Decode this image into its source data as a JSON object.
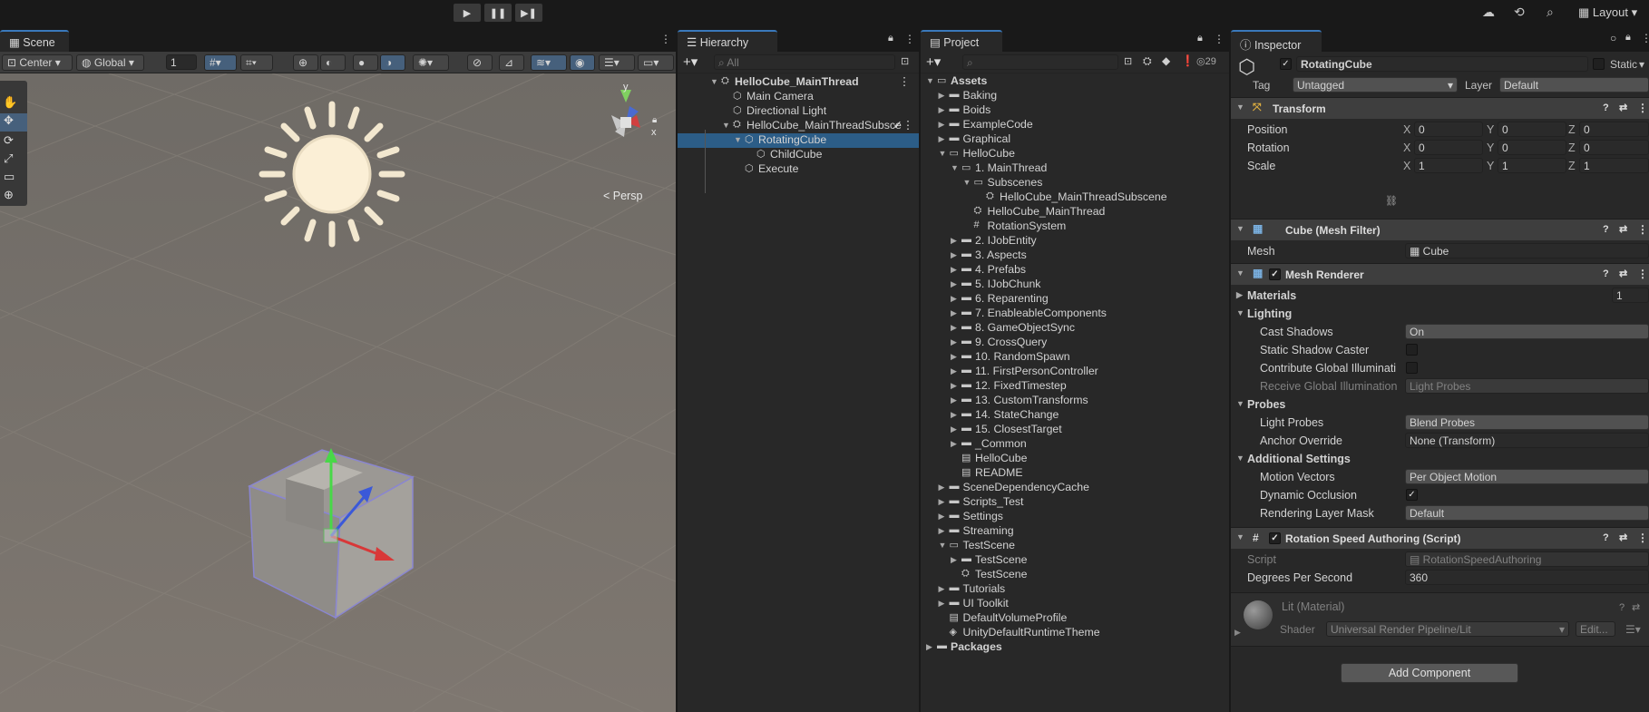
{
  "toolbar": {
    "play_icon": "play-icon",
    "pause_icon": "pause-icon",
    "step_icon": "step-icon",
    "layout_label": "Layout"
  },
  "scene": {
    "tab_label": "Scene",
    "pivot": "Center",
    "space": "Global",
    "snap_value": "1",
    "persp_label": "< Persp",
    "axes": {
      "y": "y",
      "x": "x"
    }
  },
  "hierarchy": {
    "tab_label": "Hierarchy",
    "search_placeholder": "All",
    "items": [
      {
        "label": "HelloCube_MainThread",
        "indent": 0,
        "arrow": "▼",
        "icon": "unity-scene-icon",
        "bold": true,
        "selected": false
      },
      {
        "label": "Main Camera",
        "indent": 1,
        "arrow": "",
        "icon": "gameobject-icon",
        "bold": false,
        "selected": false
      },
      {
        "label": "Directional Light",
        "indent": 1,
        "arrow": "",
        "icon": "gameobject-icon",
        "bold": false,
        "selected": false
      },
      {
        "label": "HelloCube_MainThreadSubsce",
        "indent": 1,
        "arrow": "▼",
        "icon": "subscene-icon",
        "bold": false,
        "selected": false
      },
      {
        "label": "RotatingCube",
        "indent": 2,
        "arrow": "▼",
        "icon": "gameobject-icon",
        "bold": false,
        "selected": true
      },
      {
        "label": "ChildCube",
        "indent": 3,
        "arrow": "",
        "icon": "gameobject-icon",
        "bold": false,
        "selected": false
      },
      {
        "label": "Execute",
        "indent": 2,
        "arrow": "",
        "icon": "gameobject-icon",
        "bold": false,
        "selected": false
      }
    ]
  },
  "project": {
    "tab_label": "Project",
    "hidden_count": "29",
    "items": [
      {
        "label": "Assets",
        "indent": 0,
        "arrow": "▼",
        "icon": "folder-open-icon",
        "bold": true
      },
      {
        "label": "Baking",
        "indent": 1,
        "arrow": "▶",
        "icon": "folder-icon",
        "bold": false
      },
      {
        "label": "Boids",
        "indent": 1,
        "arrow": "▶",
        "icon": "folder-icon",
        "bold": false
      },
      {
        "label": "ExampleCode",
        "indent": 1,
        "arrow": "▶",
        "icon": "folder-icon",
        "bold": false
      },
      {
        "label": "Graphical",
        "indent": 1,
        "arrow": "▶",
        "icon": "folder-icon",
        "bold": false
      },
      {
        "label": "HelloCube",
        "indent": 1,
        "arrow": "▼",
        "icon": "folder-open-icon",
        "bold": false
      },
      {
        "label": "1. MainThread",
        "indent": 2,
        "arrow": "▼",
        "icon": "folder-open-icon",
        "bold": false
      },
      {
        "label": "Subscenes",
        "indent": 3,
        "arrow": "▼",
        "icon": "folder-open-icon",
        "bold": false
      },
      {
        "label": "HelloCube_MainThreadSubscene",
        "indent": 4,
        "arrow": "",
        "icon": "unity-scene-icon",
        "bold": false
      },
      {
        "label": "HelloCube_MainThread",
        "indent": 3,
        "arrow": "",
        "icon": "unity-scene-icon",
        "bold": false
      },
      {
        "label": "RotationSystem",
        "indent": 3,
        "arrow": "",
        "icon": "script-icon",
        "bold": false
      },
      {
        "label": "2. IJobEntity",
        "indent": 2,
        "arrow": "▶",
        "icon": "folder-icon",
        "bold": false
      },
      {
        "label": "3. Aspects",
        "indent": 2,
        "arrow": "▶",
        "icon": "folder-icon",
        "bold": false
      },
      {
        "label": "4. Prefabs",
        "indent": 2,
        "arrow": "▶",
        "icon": "folder-icon",
        "bold": false
      },
      {
        "label": "5. IJobChunk",
        "indent": 2,
        "arrow": "▶",
        "icon": "folder-icon",
        "bold": false
      },
      {
        "label": "6. Reparenting",
        "indent": 2,
        "arrow": "▶",
        "icon": "folder-icon",
        "bold": false
      },
      {
        "label": "7. EnableableComponents",
        "indent": 2,
        "arrow": "▶",
        "icon": "folder-icon",
        "bold": false
      },
      {
        "label": "8. GameObjectSync",
        "indent": 2,
        "arrow": "▶",
        "icon": "folder-icon",
        "bold": false
      },
      {
        "label": "9. CrossQuery",
        "indent": 2,
        "arrow": "▶",
        "icon": "folder-icon",
        "bold": false
      },
      {
        "label": "10. RandomSpawn",
        "indent": 2,
        "arrow": "▶",
        "icon": "folder-icon",
        "bold": false
      },
      {
        "label": "11. FirstPersonController",
        "indent": 2,
        "arrow": "▶",
        "icon": "folder-icon",
        "bold": false
      },
      {
        "label": "12. FixedTimestep",
        "indent": 2,
        "arrow": "▶",
        "icon": "folder-icon",
        "bold": false
      },
      {
        "label": "13. CustomTransforms",
        "indent": 2,
        "arrow": "▶",
        "icon": "folder-icon",
        "bold": false
      },
      {
        "label": "14. StateChange",
        "indent": 2,
        "arrow": "▶",
        "icon": "folder-icon",
        "bold": false
      },
      {
        "label": "15. ClosestTarget",
        "indent": 2,
        "arrow": "▶",
        "icon": "folder-icon",
        "bold": false
      },
      {
        "label": "_Common",
        "indent": 2,
        "arrow": "▶",
        "icon": "folder-icon",
        "bold": false
      },
      {
        "label": "HelloCube",
        "indent": 2,
        "arrow": "",
        "icon": "asset-icon",
        "bold": false
      },
      {
        "label": "README",
        "indent": 2,
        "arrow": "",
        "icon": "text-asset-icon",
        "bold": false
      },
      {
        "label": "SceneDependencyCache",
        "indent": 1,
        "arrow": "▶",
        "icon": "folder-icon",
        "bold": false
      },
      {
        "label": "Scripts_Test",
        "indent": 1,
        "arrow": "▶",
        "icon": "folder-icon",
        "bold": false
      },
      {
        "label": "Settings",
        "indent": 1,
        "arrow": "▶",
        "icon": "folder-icon",
        "bold": false
      },
      {
        "label": "Streaming",
        "indent": 1,
        "arrow": "▶",
        "icon": "folder-icon",
        "bold": false
      },
      {
        "label": "TestScene",
        "indent": 1,
        "arrow": "▼",
        "icon": "folder-open-icon",
        "bold": false
      },
      {
        "label": "TestScene",
        "indent": 2,
        "arrow": "▶",
        "icon": "folder-icon",
        "bold": false
      },
      {
        "label": "TestScene",
        "indent": 2,
        "arrow": "",
        "icon": "unity-scene-icon",
        "bold": false
      },
      {
        "label": "Tutorials",
        "indent": 1,
        "arrow": "▶",
        "icon": "folder-icon",
        "bold": false
      },
      {
        "label": "UI Toolkit",
        "indent": 1,
        "arrow": "▶",
        "icon": "folder-icon",
        "bold": false
      },
      {
        "label": "DefaultVolumeProfile",
        "indent": 1,
        "arrow": "",
        "icon": "asset-icon",
        "bold": false
      },
      {
        "label": "UnityDefaultRuntimeTheme",
        "indent": 1,
        "arrow": "",
        "icon": "theme-icon",
        "bold": false
      },
      {
        "label": "Packages",
        "indent": 0,
        "arrow": "▶",
        "icon": "folder-icon",
        "bold": true
      }
    ]
  },
  "inspector": {
    "tab_label": "Inspector",
    "object_name": "RotatingCube",
    "static_label": "Static",
    "tag_label": "Tag",
    "tag_value": "Untagged",
    "layer_label": "Layer",
    "layer_value": "Default",
    "transform": {
      "title": "Transform",
      "rows": [
        {
          "label": "Position",
          "x": "0",
          "y": "0",
          "z": "0"
        },
        {
          "label": "Rotation",
          "x": "0",
          "y": "0",
          "z": "0"
        },
        {
          "label": "Scale",
          "x": "1",
          "y": "1",
          "z": "1"
        }
      ],
      "axis_x": "X",
      "axis_y": "Y",
      "axis_z": "Z"
    },
    "mesh_filter": {
      "title": "Cube (Mesh Filter)",
      "mesh_label": "Mesh",
      "mesh_value": "Cube"
    },
    "mesh_renderer": {
      "title": "Mesh Renderer",
      "materials_label": "Materials",
      "materials_count": "1",
      "lighting_label": "Lighting",
      "cast_shadows_label": "Cast Shadows",
      "cast_shadows_value": "On",
      "static_shadow_label": "Static Shadow Caster",
      "contribute_gi_label": "Contribute Global Illuminati",
      "receive_gi_label": "Receive Global Illumination",
      "receive_gi_value": "Light Probes",
      "probes_label": "Probes",
      "light_probes_label": "Light Probes",
      "light_probes_value": "Blend Probes",
      "anchor_label": "Anchor Override",
      "anchor_value": "None (Transform)",
      "additional_label": "Additional Settings",
      "motion_label": "Motion Vectors",
      "motion_value": "Per Object Motion",
      "dynamic_occlusion_label": "Dynamic Occlusion",
      "rendering_layer_label": "Rendering Layer Mask",
      "rendering_layer_value": "Default"
    },
    "script_comp": {
      "title": "Rotation Speed Authoring (Script)",
      "script_label": "Script",
      "script_value": "RotationSpeedAuthoring",
      "dps_label": "Degrees Per Second",
      "dps_value": "360"
    },
    "material": {
      "title": "Lit (Material)",
      "shader_label": "Shader",
      "shader_value": "Universal Render Pipeline/Lit",
      "edit_label": "Edit..."
    },
    "add_component": "Add Component"
  }
}
